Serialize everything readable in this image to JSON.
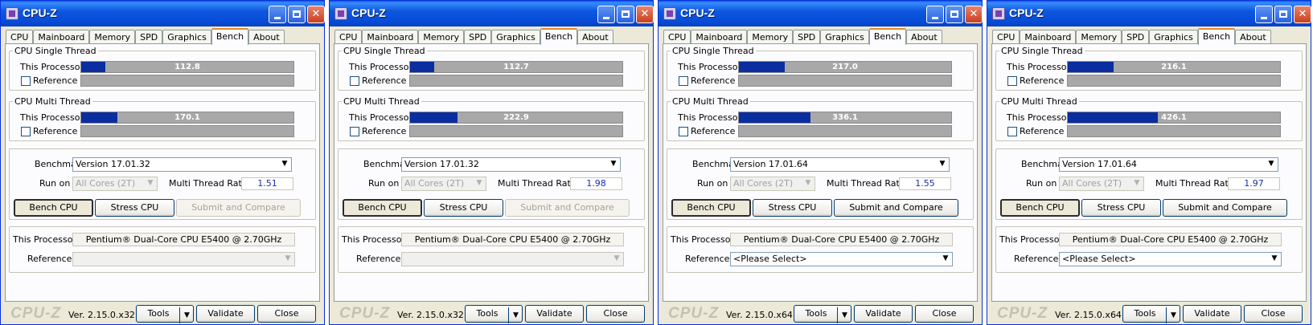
{
  "app": {
    "title": "CPU-Z",
    "tabs": [
      "CPU",
      "Mainboard",
      "Memory",
      "SPD",
      "Graphics",
      "Bench",
      "About"
    ],
    "active_tab": "Bench",
    "single_thread_label": "CPU Single Thread",
    "multi_thread_label": "CPU Multi Thread",
    "this_processor_label": "This Processor",
    "reference_label": "Reference",
    "benchmark_label": "Benchmark",
    "run_on_label": "Run on",
    "ratio_label": "Multi Thread Ratio",
    "bench_button": "Bench CPU",
    "stress_button": "Stress CPU",
    "submit_button": "Submit and Compare",
    "processor_name": "Pentium® Dual-Core  CPU      E5400  @ 2.70GHz",
    "logo": "CPU-Z",
    "tools_button": "Tools",
    "validate_button": "Validate",
    "close_button": "Close",
    "bar_scale_max": 10000,
    "colors": {
      "bar_fill": "#0a2ea0",
      "bar_bg": "#a8a8a8",
      "titlebar": "#0648d4"
    }
  },
  "windows": [
    {
      "single_score": "112.8",
      "single_value": 112.8,
      "multi_score": "170.1",
      "multi_value": 170.1,
      "benchmark_version": "Version 17.01.32",
      "run_on": "All Cores (2T)",
      "ratio": "1.51",
      "reference_select": "",
      "version": "Ver. 2.15.0.x32",
      "submit_enabled": false
    },
    {
      "single_score": "112.7",
      "single_value": 112.7,
      "multi_score": "222.9",
      "multi_value": 222.9,
      "benchmark_version": "Version 17.01.32",
      "run_on": "All Cores (2T)",
      "ratio": "1.98",
      "reference_select": "",
      "version": "Ver. 2.15.0.x32",
      "submit_enabled": false
    },
    {
      "single_score": "217.0",
      "single_value": 217.0,
      "multi_score": "336.1",
      "multi_value": 336.1,
      "benchmark_version": "Version 17.01.64",
      "run_on": "All Cores (2T)",
      "ratio": "1.55",
      "reference_select": "<Please Select>",
      "version": "Ver. 2.15.0.x64",
      "submit_enabled": true
    },
    {
      "single_score": "216.1",
      "single_value": 216.1,
      "multi_score": "426.1",
      "multi_value": 426.1,
      "benchmark_version": "Version 17.01.64",
      "run_on": "All Cores (2T)",
      "ratio": "1.97",
      "reference_select": "<Please Select>",
      "version": "Ver. 2.15.0.x64",
      "submit_enabled": true
    }
  ]
}
